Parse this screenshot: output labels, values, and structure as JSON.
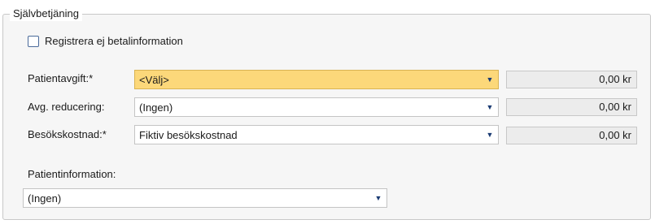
{
  "section": {
    "legend": "Självbetjäning"
  },
  "checkbox": {
    "label": "Registrera ej betalinformation",
    "checked": false
  },
  "rows": [
    {
      "label": "Patientavgift:*",
      "value": "<Välj>",
      "amount": "0,00 kr",
      "highlighted": true
    },
    {
      "label": "Avg. reducering:",
      "value": "(Ingen)",
      "amount": "0,00 kr",
      "highlighted": false
    },
    {
      "label": "Besökskostnad:*",
      "value": "Fiktiv besökskostnad",
      "amount": "0,00 kr",
      "highlighted": false
    }
  ],
  "patient_info": {
    "label": "Patientinformation:",
    "value": "(Ingen)"
  },
  "colors": {
    "highlight": "#fcd87a",
    "arrow": "#1b3b73"
  },
  "icons": {
    "dropdown": "triangle-down"
  }
}
